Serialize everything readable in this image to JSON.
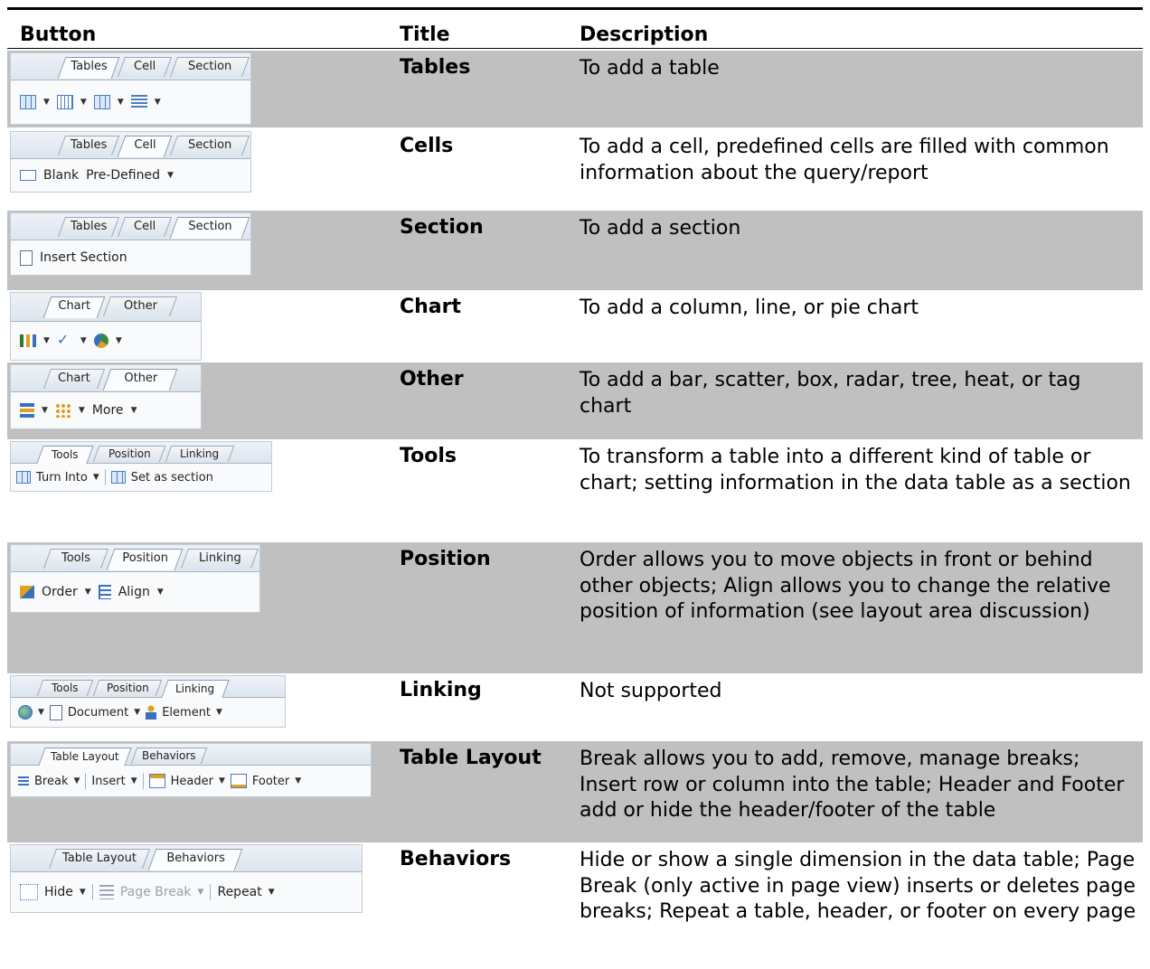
{
  "headers": {
    "button": "Button",
    "title": "Title",
    "description": "Description"
  },
  "rows": [
    {
      "title": "Tables",
      "description": "To add a table",
      "tabs": [
        "Tables",
        "Cell",
        "Section"
      ],
      "active_tab": "Tables"
    },
    {
      "title": "Cells",
      "description": "To add a cell, predefined cells are filled with common information about the query/report",
      "tabs": [
        "Tables",
        "Cell",
        "Section"
      ],
      "active_tab": "Cell",
      "tools": [
        "Blank",
        "Pre-Defined"
      ]
    },
    {
      "title": "Section",
      "description": "To add a section",
      "tabs": [
        "Tables",
        "Cell",
        "Section"
      ],
      "active_tab": "Section",
      "tools": [
        "Insert Section"
      ]
    },
    {
      "title": "Chart",
      "description": "To add a column, line, or pie chart",
      "tabs": [
        "Chart",
        "Other"
      ],
      "active_tab": "Chart"
    },
    {
      "title": "Other",
      "description": "To add a bar, scatter, box, radar, tree, heat, or tag chart",
      "tabs": [
        "Chart",
        "Other"
      ],
      "active_tab": "Other",
      "tools": [
        "More"
      ]
    },
    {
      "title": "Tools",
      "description": "To transform a table into a different kind of table or chart; setting information in the data table as a section",
      "tabs": [
        "Tools",
        "Position",
        "Linking"
      ],
      "active_tab": "Tools",
      "tools": [
        "Turn Into",
        "Set as section"
      ]
    },
    {
      "title": "Position",
      "description": "Order allows you to move objects in front or behind other objects; Align allows you to change the relative position of information (see layout area discussion)",
      "tabs": [
        "Tools",
        "Position",
        "Linking"
      ],
      "active_tab": "Position",
      "tools": [
        "Order",
        "Align"
      ]
    },
    {
      "title": "Linking",
      "description": "Not supported",
      "tabs": [
        "Tools",
        "Position",
        "Linking"
      ],
      "active_tab": "Linking",
      "tools": [
        "Document",
        "Element"
      ]
    },
    {
      "title": "Table Layout",
      "description": "Break allows you to add, remove, manage breaks; Insert row or column into the table; Header and Footer add or hide the header/footer of the table",
      "tabs": [
        "Table Layout",
        "Behaviors"
      ],
      "active_tab": "Table Layout",
      "tools": [
        "Break",
        "Insert",
        "Header",
        "Footer"
      ]
    },
    {
      "title": "Behaviors",
      "description": "Hide or show a single dimension in the data table; Page Break (only active in page view) inserts or deletes page breaks; Repeat a table, header, or footer on every page",
      "tabs": [
        "Table Layout",
        "Behaviors"
      ],
      "active_tab": "Behaviors",
      "tools": [
        "Hide",
        "Page Break",
        "Repeat"
      ]
    }
  ],
  "colors": {
    "shade": "#c0c0c0",
    "rule": "#000000",
    "toolbar_border": "#c2ccd8",
    "icon_blue": "#4a7fc1"
  }
}
